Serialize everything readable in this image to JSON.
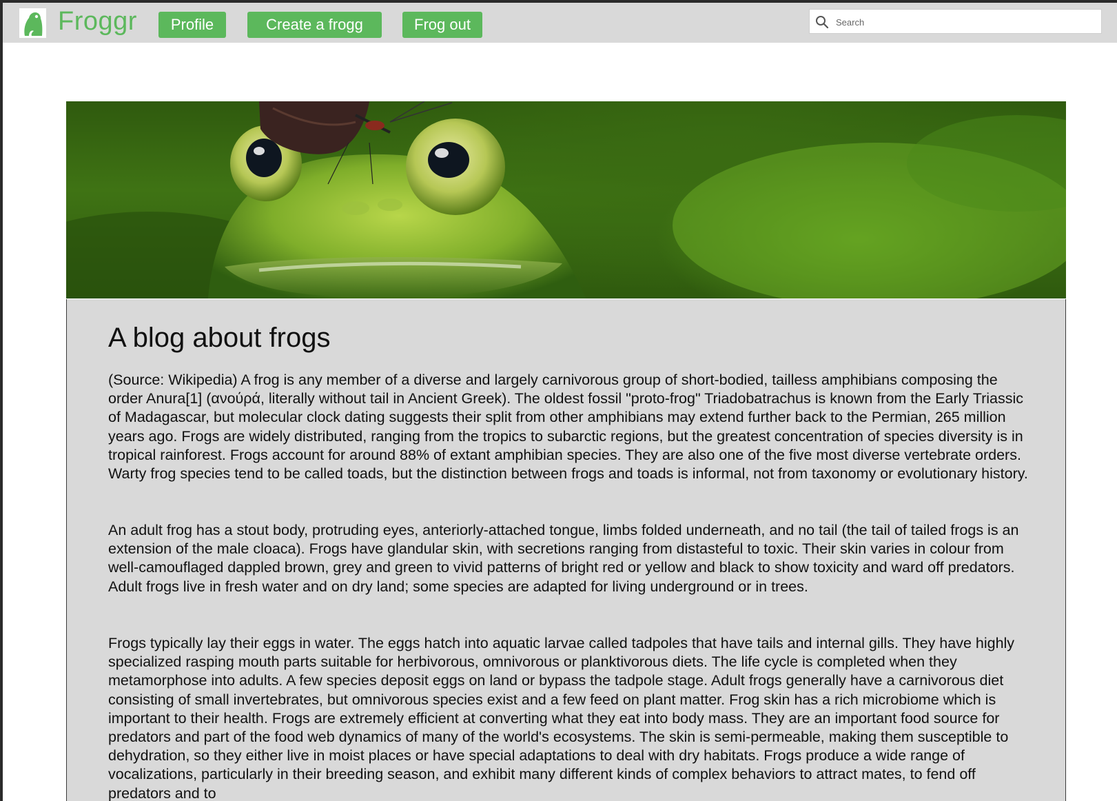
{
  "header": {
    "logo_icon": "frog-logo-icon",
    "brand": "Froggr",
    "nav": [
      {
        "label": "Profile"
      },
      {
        "label": "Create a frogg"
      },
      {
        "label": "Frog out"
      }
    ],
    "search": {
      "placeholder": "Search",
      "icon": "search-icon"
    }
  },
  "hero": {
    "description": "frog-with-butterfly-banner"
  },
  "post": {
    "title": "A blog about frogs",
    "paragraphs": [
      "(Source: Wikipedia) A frog is any member of a diverse and largely carnivorous group of short-bodied, tailless amphibians composing the order Anura[1] (ανούρά, literally without tail in Ancient Greek). The oldest fossil \"proto-frog\" Triadobatrachus is known from the Early Triassic of Madagascar, but molecular clock dating suggests their split from other amphibians may extend further back to the Permian, 265 million years ago. Frogs are widely distributed, ranging from the tropics to subarctic regions, but the greatest concentration of species diversity is in tropical rainforest. Frogs account for around 88% of extant amphibian species. They are also one of the five most diverse vertebrate orders. Warty frog species tend to be called toads, but the distinction between frogs and toads is informal, not from taxonomy or evolutionary history.",
      "An adult frog has a stout body, protruding eyes, anteriorly-attached tongue, limbs folded underneath, and no tail (the tail of tailed frogs is an extension of the male cloaca). Frogs have glandular skin, with secretions ranging from distasteful to toxic. Their skin varies in colour from well-camouflaged dappled brown, grey and green to vivid patterns of bright red or yellow and black to show toxicity and ward off predators. Adult frogs live in fresh water and on dry land; some species are adapted for living underground or in trees.",
      "Frogs typically lay their eggs in water. The eggs hatch into aquatic larvae called tadpoles that have tails and internal gills. They have highly specialized rasping mouth parts suitable for herbivorous, omnivorous or planktivorous diets. The life cycle is completed when they metamorphose into adults. A few species deposit eggs on land or bypass the tadpole stage. Adult frogs generally have a carnivorous diet consisting of small invertebrates, but omnivorous species exist and a few feed on plant matter. Frog skin has a rich microbiome which is important to their health. Frogs are extremely efficient at converting what they eat into body mass. They are an important food source for predators and part of the food web dynamics of many of the world's ecosystems. The skin is semi-permeable, making them susceptible to dehydration, so they either live in moist places or have special adaptations to deal with dry habitats. Frogs produce a wide range of vocalizations, particularly in their breeding season, and exhibit many different kinds of complex behaviors to attract mates, to fend off predators and to"
    ]
  },
  "colors": {
    "accent": "#5cb85c",
    "navbar_bg": "#d9d9d9",
    "content_bg": "#d9d9d9",
    "frame": "#2b2b2b"
  }
}
